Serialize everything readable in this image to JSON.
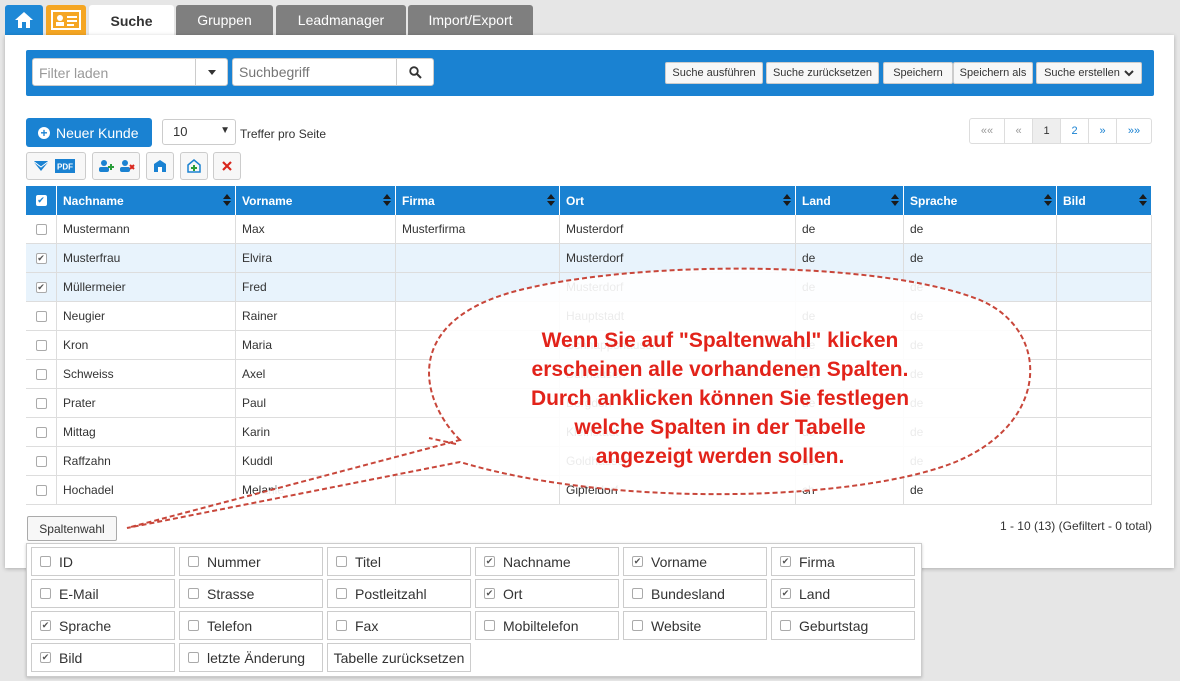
{
  "tabs": [
    {
      "label": "Suche",
      "active": true
    },
    {
      "label": "Gruppen",
      "active": false
    },
    {
      "label": "Leadmanager",
      "active": false
    },
    {
      "label": "Import/Export",
      "active": false
    }
  ],
  "search": {
    "filter_placeholder": "Filter laden",
    "term_placeholder": "Suchbegriff",
    "buttons": [
      "Suche ausführen",
      "Suche zurücksetzen",
      "Speichern",
      "Speichern als",
      "Suche erstellen"
    ]
  },
  "toolbar": {
    "new_customer": "Neuer Kunde",
    "per_page_value": "10",
    "per_page_label": "Treffer pro Seite",
    "pdf_label": "PDF"
  },
  "pager": [
    "««",
    "«",
    "1",
    "2",
    "»",
    "»»"
  ],
  "table": {
    "headers": [
      "Nachname",
      "Vorname",
      "Firma",
      "Ort",
      "Land",
      "Sprache",
      "Bild"
    ],
    "rows": [
      {
        "checked": false,
        "cells": [
          "Mustermann",
          "Max",
          "Musterfirma",
          "Musterdorf",
          "de",
          "de",
          ""
        ]
      },
      {
        "checked": true,
        "cells": [
          "Musterfrau",
          "Elvira",
          "",
          "Musterdorf",
          "de",
          "de",
          ""
        ]
      },
      {
        "checked": true,
        "cells": [
          "Müllermeier",
          "Fred",
          "",
          "Musterdorf",
          "de",
          "de",
          ""
        ]
      },
      {
        "checked": false,
        "cells": [
          "Neugier",
          "Rainer",
          "",
          "Hauptstadt",
          "de",
          "de",
          ""
        ]
      },
      {
        "checked": false,
        "cells": [
          "Kron",
          "Maria",
          "",
          "Schnappshausen",
          "de",
          "de",
          ""
        ]
      },
      {
        "checked": false,
        "cells": [
          "Schweiss",
          "Axel",
          "",
          "Bullhausen",
          "de",
          "de",
          ""
        ]
      },
      {
        "checked": false,
        "cells": [
          "Prater",
          "Paul",
          "",
          "Bergdorf",
          "de",
          "de",
          ""
        ]
      },
      {
        "checked": false,
        "cells": [
          "Mittag",
          "Karin",
          "",
          "Kleinstadt",
          "de",
          "de",
          ""
        ]
      },
      {
        "checked": false,
        "cells": [
          "Raffzahn",
          "Kuddl",
          "",
          "Goldhausen",
          "de",
          "de",
          ""
        ]
      },
      {
        "checked": false,
        "cells": [
          "Hochadel",
          "Melanie",
          "",
          "Gipfeldorf",
          "ch",
          "de",
          ""
        ]
      }
    ]
  },
  "column_select_label": "Spaltenwahl",
  "info_text": "1 - 10 (13) (Gefiltert - 0 total)",
  "columns": [
    {
      "label": "ID",
      "checked": false
    },
    {
      "label": "Nummer",
      "checked": false
    },
    {
      "label": "Titel",
      "checked": false
    },
    {
      "label": "Nachname",
      "checked": true
    },
    {
      "label": "Vorname",
      "checked": true
    },
    {
      "label": "Firma",
      "checked": true
    },
    {
      "label": "E-Mail",
      "checked": false
    },
    {
      "label": "Strasse",
      "checked": false
    },
    {
      "label": "Postleitzahl",
      "checked": false
    },
    {
      "label": "Ort",
      "checked": true
    },
    {
      "label": "Bundesland",
      "checked": false
    },
    {
      "label": "Land",
      "checked": true
    },
    {
      "label": "Sprache",
      "checked": true
    },
    {
      "label": "Telefon",
      "checked": false
    },
    {
      "label": "Fax",
      "checked": false
    },
    {
      "label": "Mobiltelefon",
      "checked": false
    },
    {
      "label": "Website",
      "checked": false
    },
    {
      "label": "Geburtstag",
      "checked": false
    },
    {
      "label": "Bild",
      "checked": true
    },
    {
      "label": "letzte Änderung",
      "checked": false
    }
  ],
  "reset_table_label": "Tabelle zurücksetzen",
  "callout_lines": [
    "Wenn Sie auf \"Spaltenwahl\" klicken",
    "erscheinen alle vorhandenen Spalten.",
    "Durch anklicken können Sie festlegen",
    "welche Spalten in der Tabelle",
    "angezeigt werden sollen."
  ],
  "colors": {
    "accent": "#1a82d2",
    "callout": "#e2231a",
    "home_tab": "#1e88d6",
    "card_tab": "#f5a623"
  }
}
